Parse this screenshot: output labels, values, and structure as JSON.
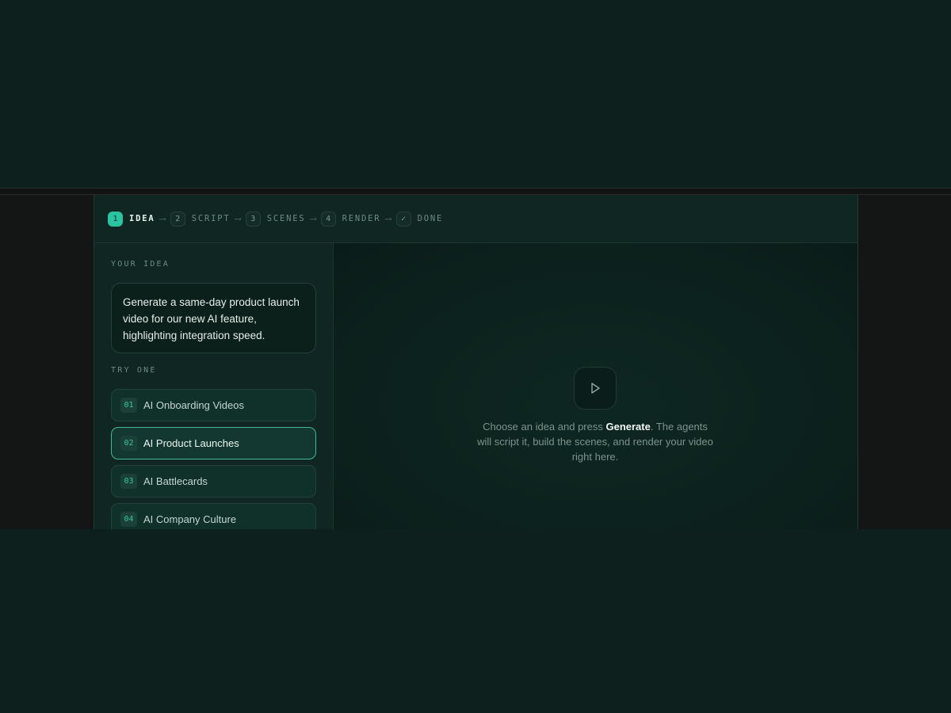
{
  "stepper": {
    "steps": [
      {
        "num": "1",
        "label": "IDEA"
      },
      {
        "num": "2",
        "label": "SCRIPT"
      },
      {
        "num": "3",
        "label": "SCENES"
      },
      {
        "num": "4",
        "label": "RENDER"
      },
      {
        "num": "✓",
        "label": "DONE"
      }
    ],
    "arrow": "⟶",
    "active_step": "IDEA"
  },
  "idea": {
    "section_label": "YOUR IDEA",
    "text": "Generate a same-day product launch video for our new AI feature, highlighting integration speed."
  },
  "try_one": {
    "section_label": "TRY ONE",
    "options": [
      {
        "num": "01",
        "label": "AI Onboarding Videos"
      },
      {
        "num": "02",
        "label": "AI Product Launches"
      },
      {
        "num": "03",
        "label": "AI Battlecards"
      },
      {
        "num": "04",
        "label": "AI Company Culture"
      }
    ],
    "selected": "AI Product Launches"
  },
  "preview": {
    "icon": "play-icon",
    "hint_before": "Choose an idea and press ",
    "hint_bold": "Generate",
    "hint_after": ". The agents will script it, build the scenes, and render your video right here."
  },
  "colors": {
    "accent": "#2bc4a0",
    "background": "#0d201d",
    "panel": "#0f2622"
  }
}
